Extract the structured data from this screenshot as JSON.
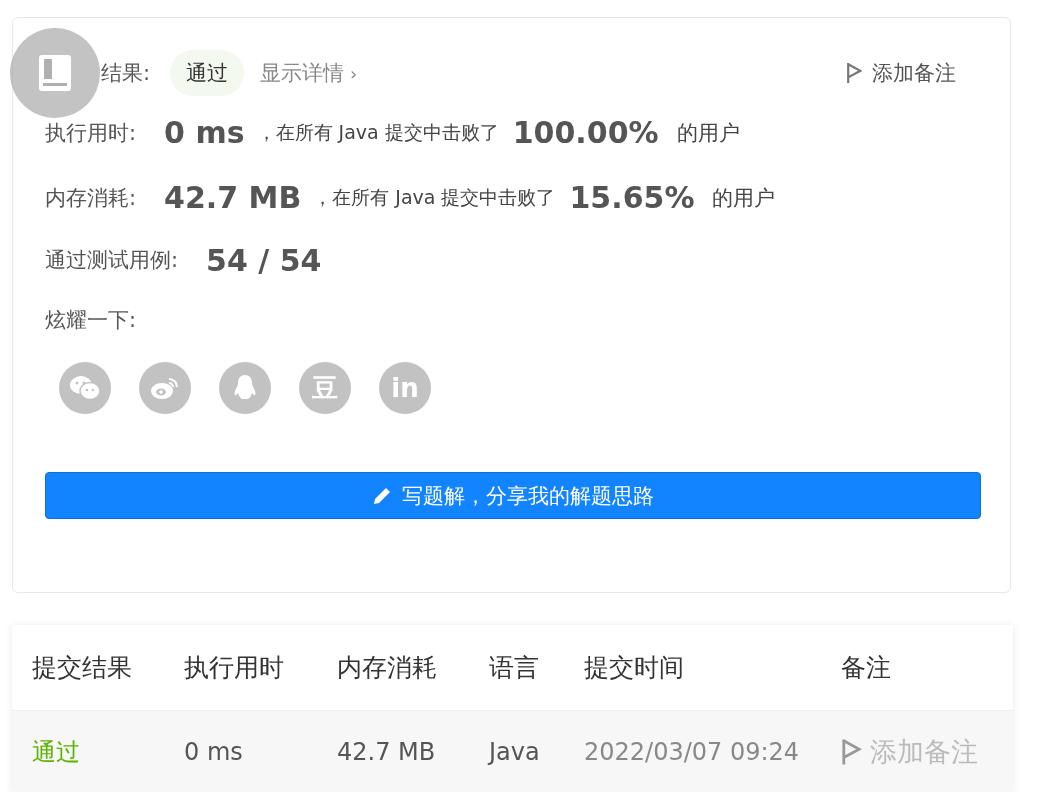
{
  "result": {
    "label": "结果:",
    "status": "通过",
    "details_link": "显示详情",
    "details_arrow": "›",
    "note_button": "添加备注"
  },
  "stats": [
    {
      "label": "执行用时:",
      "value": "0 ms",
      "middle": "，在所有 Java 提交中击败了",
      "percent": "100.00%",
      "suffix": "的用户"
    },
    {
      "label": "内存消耗:",
      "value": "42.7 MB",
      "middle": "，在所有 Java 提交中击败了",
      "percent": "15.65%",
      "suffix": "的用户"
    }
  ],
  "tests": {
    "label": "通过测试用例:",
    "value": "54 / 54"
  },
  "share": {
    "label": "炫耀一下:",
    "items": [
      {
        "kind": "wechat"
      },
      {
        "kind": "weibo"
      },
      {
        "kind": "qq"
      },
      {
        "kind": "douban",
        "glyph": "豆"
      },
      {
        "kind": "linkedin",
        "glyph": "in"
      }
    ]
  },
  "write_button": "写题解，分享我的解题思路",
  "table": {
    "columns": [
      "提交结果",
      "执行用时",
      "内存消耗",
      "语言",
      "提交时间",
      "备注"
    ],
    "rows": [
      {
        "status": "通过",
        "passed": true,
        "runtime": "0 ms",
        "memory": "42.7 MB",
        "language": "Java",
        "time": "2022/03/07 09:24",
        "note": "添加备注"
      }
    ]
  }
}
